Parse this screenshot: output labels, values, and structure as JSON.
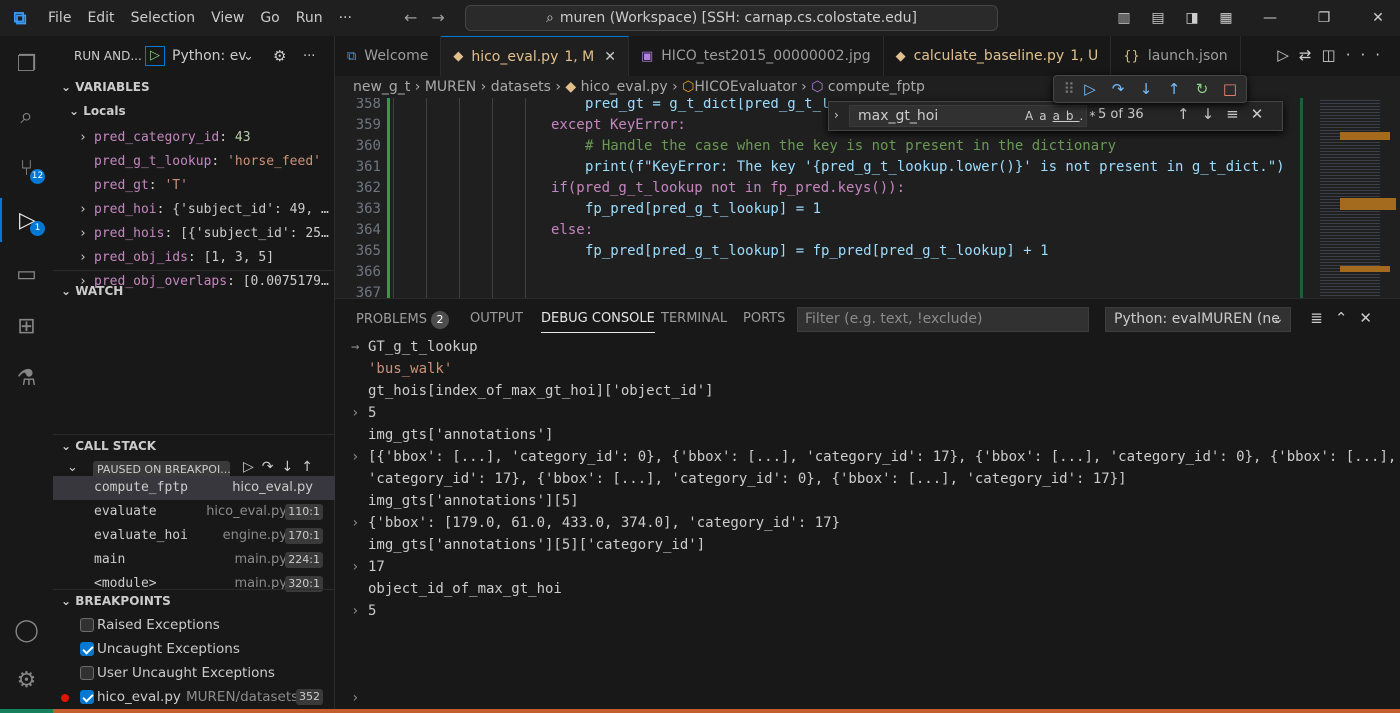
{
  "titlebar": {
    "menu": [
      "File",
      "Edit",
      "Selection",
      "View",
      "Go",
      "Run",
      "···"
    ],
    "command_center": "muren (Workspace) [SSH: carnap.cs.colostate.edu]"
  },
  "activity": {
    "scm_badge": "12",
    "debug_badge": "1"
  },
  "sidebar": {
    "run_label": "RUN AND...",
    "config": "Python: ev",
    "variables_title": "VARIABLES",
    "locals_title": "Locals",
    "variables": [
      {
        "name": "pred_category_id",
        "value": "43",
        "expand": "›"
      },
      {
        "name": "pred_g_t_lookup",
        "value": "'horse_feed'",
        "expand": ""
      },
      {
        "name": "pred_gt",
        "value": "'T'",
        "expand": ""
      },
      {
        "name": "pred_hoi",
        "value": "{'subject_id': 49, …",
        "expand": "›"
      },
      {
        "name": "pred_hois",
        "value": "[{'subject_id': 25…",
        "expand": "›"
      },
      {
        "name": "pred_obj_ids",
        "value": "[1, 3, 5]",
        "expand": "›"
      },
      {
        "name": "pred_obj_overlaps",
        "value": "[0.0075179…",
        "expand": "›"
      }
    ],
    "watch_title": "WATCH",
    "callstack_title": "CALL STACK",
    "paused_label": "PAUSED ON BREAKPOI...",
    "frames": [
      {
        "fn": "compute_fptp",
        "file": "hico_eval.py",
        "line": ""
      },
      {
        "fn": "evaluate",
        "file": "hico_eval.py",
        "line": "110:1"
      },
      {
        "fn": "evaluate_hoi",
        "file": "engine.py",
        "line": "170:1"
      },
      {
        "fn": "main",
        "file": "main.py",
        "line": "224:1"
      },
      {
        "fn": "<module>",
        "file": "main.py",
        "line": "320:1"
      }
    ],
    "breakpoints_title": "BREAKPOINTS",
    "breakpoints": [
      {
        "label": "Raised Exceptions",
        "checked": false
      },
      {
        "label": "Uncaught Exceptions",
        "checked": true
      },
      {
        "label": "User Uncaught Exceptions",
        "checked": false
      }
    ],
    "bp_file": {
      "label": "hico_eval.py",
      "path": "MUREN/datasets",
      "line": "352"
    }
  },
  "tabs": [
    {
      "label": "Welcome",
      "suffix": "",
      "icon": "vscode-icon"
    },
    {
      "label": "hico_eval.py",
      "suffix": "1, M",
      "icon": "python-icon"
    },
    {
      "label": "HICO_test2015_00000002.jpg",
      "suffix": "",
      "icon": "image-icon"
    },
    {
      "label": "calculate_baseline.py",
      "suffix": "1, U",
      "icon": "python-icon"
    },
    {
      "label": "launch.json",
      "suffix": "",
      "icon": "json-icon"
    }
  ],
  "breadcrumbs": [
    "new_g_t",
    "MUREN",
    "datasets",
    "hico_eval.py",
    "HICOEvaluator",
    "compute_fptp"
  ],
  "find": {
    "query": "max_gt_hoi",
    "count": "5 of 36",
    "opt_case": "Aa",
    "opt_word": "ab",
    "opt_regex": ".*"
  },
  "code": [
    {
      "n": "358",
      "text": "pred_gt = g_t_dict[pred_g_t_l"
    },
    {
      "n": "359",
      "text": "except KeyError:"
    },
    {
      "n": "360",
      "text": "# Handle the case when the key is not present in the dictionary"
    },
    {
      "n": "361",
      "text": "print(f\"KeyError: The key '{pred_g_t_lookup.lower()}' is not present in g_t_dict.\")"
    },
    {
      "n": "362",
      "text": "if(pred_g_t_lookup not in fp_pred.keys()):"
    },
    {
      "n": "363",
      "text": "fp_pred[pred_g_t_lookup] = 1"
    },
    {
      "n": "364",
      "text": "else:"
    },
    {
      "n": "365",
      "text": "fp_pred[pred_g_t_lookup] = fp_pred[pred_g_t_lookup] + 1"
    },
    {
      "n": "366",
      "text": ""
    },
    {
      "n": "367",
      "text": ""
    }
  ],
  "panel": {
    "tabs": [
      "PROBLEMS",
      "OUTPUT",
      "DEBUG CONSOLE",
      "TERMINAL",
      "PORTS"
    ],
    "problems_count": "2",
    "filter_placeholder": "Filter (e.g. text, !exclude)",
    "selector": "Python: evalMUREN (ne"
  },
  "console": [
    {
      "glyph": "→",
      "text": "GT_g_t_lookup",
      "kind": "input"
    },
    {
      "glyph": "",
      "text": "'bus_walk'",
      "kind": "string"
    },
    {
      "glyph": "",
      "text": "gt_hois[index_of_max_gt_hoi]['object_id']",
      "kind": "input"
    },
    {
      "glyph": "›",
      "text": "5",
      "kind": "output"
    },
    {
      "glyph": "",
      "text": "img_gts['annotations']",
      "kind": "input"
    },
    {
      "glyph": "›",
      "text": "[{'bbox': [...], 'category_id': 0}, {'bbox': [...], 'category_id': 17}, {'bbox': [...], 'category_id': 0}, {'bbox': [...],",
      "kind": "output"
    },
    {
      "glyph": "",
      "text": "'category_id': 17}, {'bbox': [...], 'category_id': 0}, {'bbox': [...], 'category_id': 17}]",
      "kind": "output"
    },
    {
      "glyph": "",
      "text": "img_gts['annotations'][5]",
      "kind": "input"
    },
    {
      "glyph": "›",
      "text": "{'bbox': [179.0, 61.0, 433.0, 374.0], 'category_id': 17}",
      "kind": "output"
    },
    {
      "glyph": "",
      "text": "img_gts['annotations'][5]['category_id']",
      "kind": "input"
    },
    {
      "glyph": "›",
      "text": "17",
      "kind": "output"
    },
    {
      "glyph": "",
      "text": "object_id_of_max_gt_hoi",
      "kind": "input"
    },
    {
      "glyph": "›",
      "text": "5",
      "kind": "output"
    }
  ],
  "prompt": "›"
}
